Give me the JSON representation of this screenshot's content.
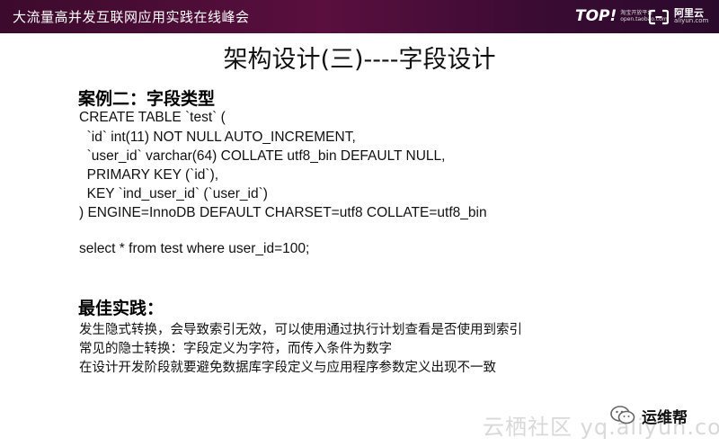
{
  "banner": {
    "title": "大流量高并发互联网应用实践在线峰会",
    "top_logo": "TOP!",
    "top_logo_sub1": "淘宝开放平台",
    "top_logo_sub2": "open.taobao.com",
    "ali_cn": "阿里云",
    "ali_en": "aliyun.com"
  },
  "slide": {
    "title": "架构设计(三)----字段设计",
    "case_heading": "案例二：字段类型",
    "code_lines": [
      "CREATE TABLE `test` (",
      "  `id` int(11) NOT NULL AUTO_INCREMENT,",
      "  `user_id` varchar(64) COLLATE utf8_bin DEFAULT NULL,",
      "  PRIMARY KEY (`id`),",
      "  KEY `ind_user_id` (`user_id`)",
      ") ENGINE=InnoDB DEFAULT CHARSET=utf8 COLLATE=utf8_bin"
    ],
    "select_line": "select * from test where user_id=100;",
    "best_heading": "最佳实践：",
    "notes": [
      "发生隐式转换，会导致索引无效，可以使用通过执行计划查看是否使用到索引",
      "常见的隐士转换：字段定义为字符，而传入条件为数字",
      "在设计开发阶段就要避免数据库字段定义与应用程序参数定义出现不一致"
    ]
  },
  "footer": {
    "watermark": "云栖社区 yq.aliyun.com",
    "wechat_label": "运维帮"
  }
}
